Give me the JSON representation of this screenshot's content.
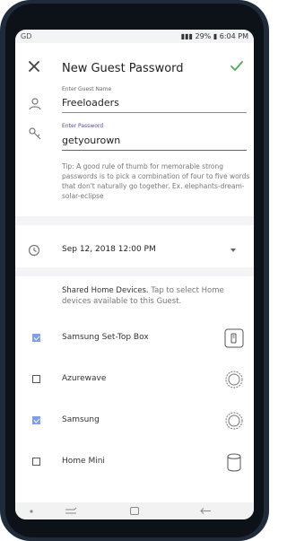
{
  "status_bar": {
    "left_text": "GD",
    "battery": "29%",
    "time": "6:04 PM"
  },
  "header": {
    "title": "New Guest Password",
    "close_icon": "close-icon",
    "confirm_icon": "check-icon"
  },
  "form": {
    "guest_name": {
      "label": "Enter Guest Name",
      "value": "Freeloaders",
      "icon": "person-icon"
    },
    "password": {
      "label": "Enter Password",
      "value": "getyourown",
      "icon": "key-icon"
    },
    "tip": "Tip: A good rule of thumb for memorable strong passwords is to pick a combination of four to five words that don't naturally go together. Ex. elephants-dream-solar-eclipse"
  },
  "schedule": {
    "datetime": "Sep 12, 2018 12:00 PM",
    "icon": "clock-icon"
  },
  "shared_devices": {
    "heading": "Shared Home Devices.",
    "description": " Tap to select Home devices available to this Guest.",
    "items": [
      {
        "label": "Samsung Set-Top Box",
        "checked": true,
        "icon": "set-top-box-icon"
      },
      {
        "label": "Azurewave",
        "checked": false,
        "icon": "generic-device-icon"
      },
      {
        "label": "Samsung",
        "checked": true,
        "icon": "generic-device-icon"
      },
      {
        "label": "Home Mini",
        "checked": false,
        "icon": "home-mini-icon"
      }
    ]
  },
  "colors": {
    "accent_check": "#4caf50",
    "checkbox_checked": "#7f9ee6",
    "password_underline": "#5b5bbe"
  }
}
